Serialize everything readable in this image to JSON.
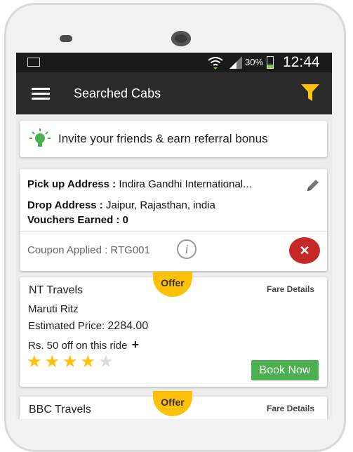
{
  "statusbar": {
    "battery": "30%",
    "battery_level": 0.3,
    "time": "12:44"
  },
  "toolbar": {
    "title": "Searched Cabs"
  },
  "invite": {
    "text": "Invite your friends & earn referral bonus"
  },
  "booking": {
    "pickup_label": "Pick up Address :",
    "pickup_value": "Indira Gandhi International...",
    "drop_label": "Drop Address :",
    "drop_value": "Jaipur, Rajasthan, india",
    "vouchers_label": "Vouchers Earned :",
    "vouchers_value": "0",
    "coupon": "Coupon Applied : RTG001",
    "info_glyph": "i",
    "close_glyph": "✕"
  },
  "cabs": [
    {
      "name": "NT Travels",
      "offer": "Offer",
      "fare_details": "Fare Details",
      "car": "Maruti Ritz",
      "price_label": "Estimated Price:",
      "price_value": "2284.00",
      "discount": "Rs. 50 off on this ride",
      "rating": 4,
      "rating_max": 5,
      "book_label": "Book Now"
    },
    {
      "name": "BBC Travels",
      "offer": "Offer",
      "fare_details": "Fare Details"
    }
  ],
  "colors": {
    "toolbar": "#2b2b2b",
    "accent": "#ffc107",
    "close": "#c62828",
    "book": "#4caf50"
  },
  "icons": [
    "image-icon",
    "wifi-icon",
    "signal-icon",
    "battery-icon",
    "menu-icon",
    "filter-icon",
    "bulb-icon",
    "pencil-icon",
    "info-icon",
    "close-icon",
    "plus-icon",
    "star-icon"
  ]
}
